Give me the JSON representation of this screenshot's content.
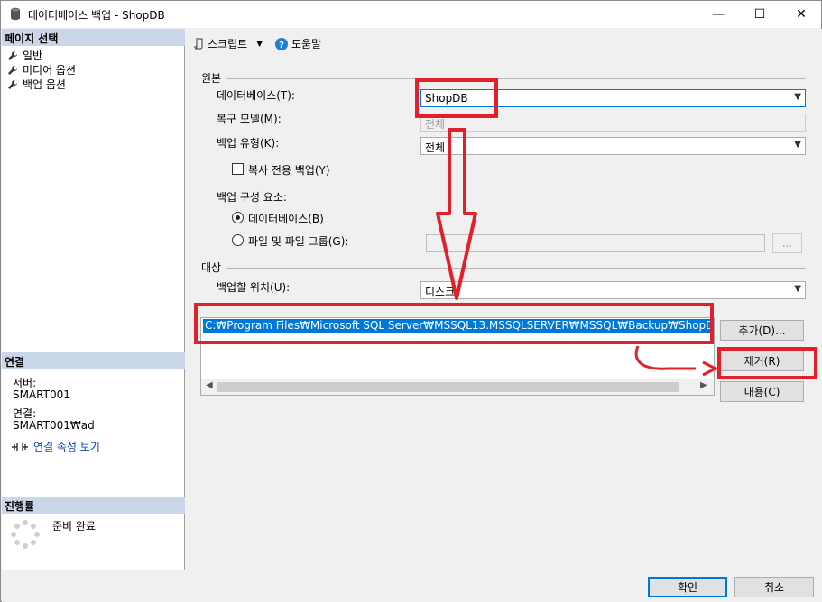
{
  "window": {
    "title": "데이터베이스 백업 - ShopDB",
    "minimize": "—",
    "maximize": "☐",
    "close": "✕"
  },
  "left": {
    "page_select_header": "페이지 선택",
    "pages": [
      "일반",
      "미디어 옵션",
      "백업 옵션"
    ],
    "connection_header": "연결",
    "server_label": "서버:",
    "server_value": "SMART001",
    "connection_label": "연결:",
    "connection_value": "SMART001₩ad",
    "view_connection_props": "연결 속성 보기",
    "progress_header": "진행률",
    "progress_status": "준비 완료"
  },
  "toolbar": {
    "script_label": "스크립트",
    "help_label": "도움말"
  },
  "source": {
    "group_label": "원본",
    "database_label": "데이터베이스(T):",
    "database_value": "ShopDB",
    "recovery_label": "복구 모델(M):",
    "recovery_value": "전체",
    "backup_type_label": "백업 유형(K):",
    "backup_type_value": "전체",
    "copy_only_label": "복사 전용 백업(Y)",
    "component_label": "백업 구성 요소:",
    "component_database": "데이터베이스(B)",
    "component_files": "파일 및 파일 그룹(G):",
    "browse_label": "..."
  },
  "destination": {
    "group_label": "대상",
    "backup_to_label": "백업할 위치(U):",
    "backup_to_value": "디스크",
    "paths": [
      "C:₩Program Files₩Microsoft SQL Server₩MSSQL13.MSSQLSERVER₩MSSQL₩Backup₩ShopDB"
    ],
    "add_button": "추가(D)...",
    "remove_button": "제거(R)",
    "contents_button": "내용(C)"
  },
  "footer": {
    "ok_button": "확인",
    "cancel_button": "취소"
  },
  "colors": {
    "annotation_red": "#e0202a",
    "selection_blue": "#0078d7",
    "section_header": "#c9d7e8"
  }
}
